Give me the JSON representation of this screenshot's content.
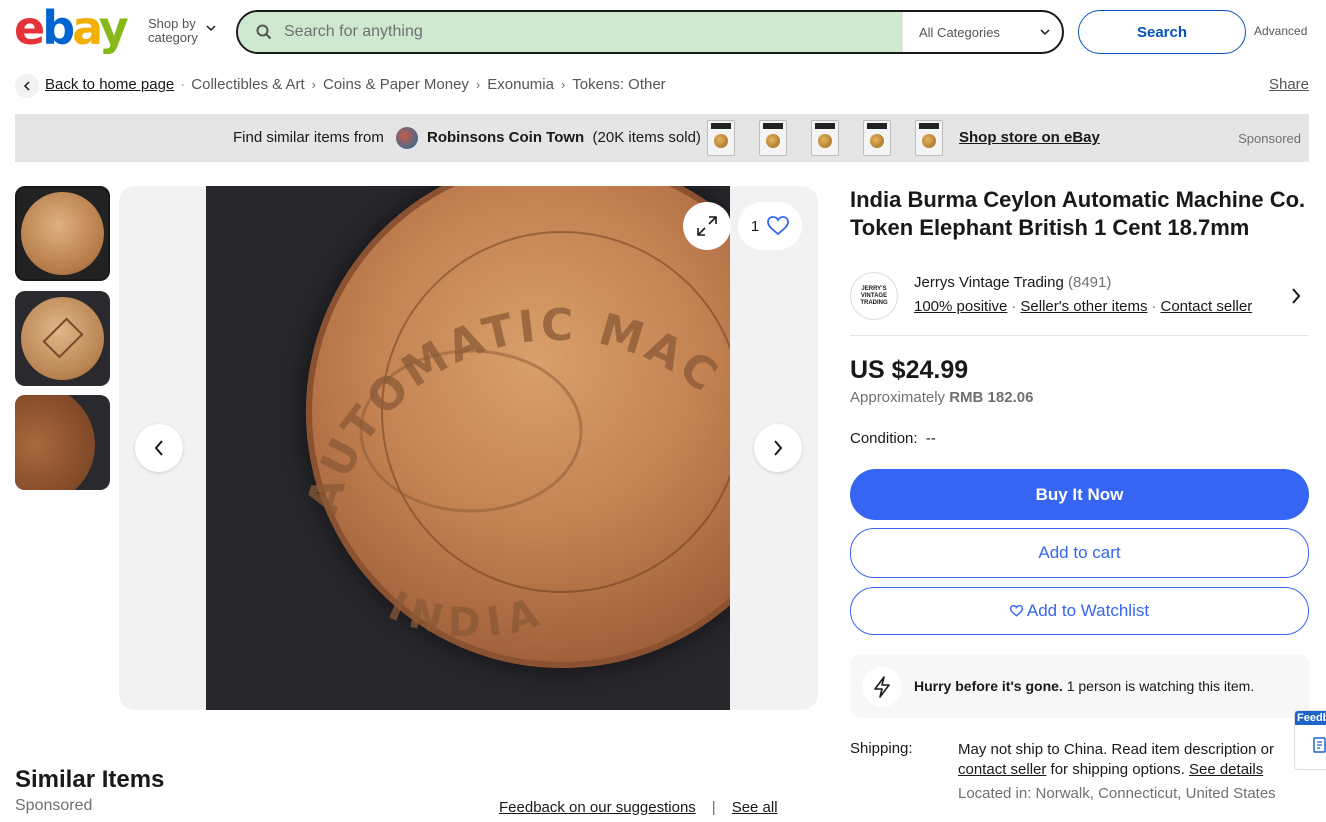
{
  "header": {
    "logo": [
      "e",
      "b",
      "a",
      "y"
    ],
    "shop_by_line1": "Shop by",
    "shop_by_line2": "category",
    "search_placeholder": "Search for anything",
    "category_select": "All Categories",
    "search_button": "Search",
    "advanced": "Advanced"
  },
  "breadcrumb": {
    "home": "Back to home page",
    "items": [
      "Collectibles & Art",
      "Coins & Paper Money",
      "Exonumia",
      "Tokens: Other"
    ],
    "share": "Share"
  },
  "sponsored_strip": {
    "prefix": "Find similar items from",
    "store_name": "Robinsons Coin Town",
    "items_sold": "(20K items sold)",
    "shop_link": "Shop store on eBay",
    "sponsored": "Sponsored"
  },
  "gallery": {
    "watch_count": "1",
    "coin_text_top": "AUTOMATIC MACHINE CO.",
    "coin_text_bottom": "INDIA"
  },
  "listing": {
    "title": "India Burma Ceylon Automatic Machine Co. Token Elephant British 1 Cent 18.7mm",
    "seller_name": "Jerrys Vintage Trading",
    "seller_feedback": "(8491)",
    "seller_logo_text": "JERRY'S VINTAGE TRADING",
    "seller_positive": "100% positive",
    "seller_other_items": "Seller's other items",
    "contact_seller": "Contact seller",
    "price": "US $24.99",
    "approx_prefix": "Approximately",
    "approx_value": "RMB 182.06",
    "condition_label": "Condition:",
    "condition_value": "--",
    "buy_now": "Buy It Now",
    "add_to_cart": "Add to cart",
    "add_to_watchlist": "Add to Watchlist",
    "hurry_bold": "Hurry before it's gone.",
    "hurry_rest": "1 person is watching this item.",
    "shipping_label": "Shipping:",
    "shipping_text_1": "May not ship to China. Read item description or",
    "shipping_contact": "contact seller",
    "shipping_text_2": "for shipping options.",
    "shipping_details": "See details",
    "located": "Located in: Norwalk, Connecticut, United States"
  },
  "feedback_tab": "Feedback",
  "similar": {
    "title": "Similar Items",
    "sponsored": "Sponsored",
    "feedback_link": "Feedback on our suggestions",
    "see_all": "See all"
  },
  "colors": {
    "accent_blue": "#3665f3",
    "search_field_bg": "#cfe9d1",
    "logo_red": "#e53238",
    "logo_blue": "#0064d2",
    "logo_yellow": "#f5af02",
    "logo_green": "#86b817"
  }
}
